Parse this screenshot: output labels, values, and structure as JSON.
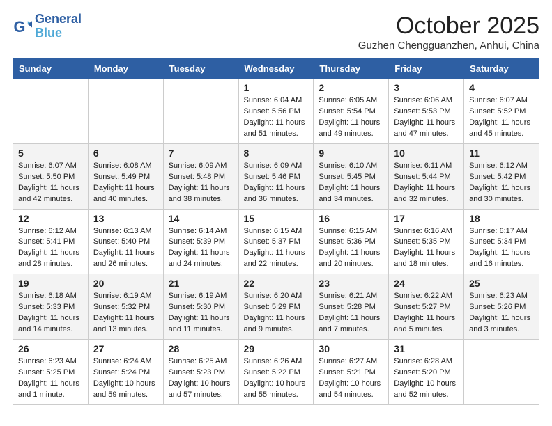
{
  "header": {
    "logo_line1": "General",
    "logo_line2": "Blue",
    "month": "October 2025",
    "location": "Guzhen Chengguanzhen, Anhui, China"
  },
  "weekdays": [
    "Sunday",
    "Monday",
    "Tuesday",
    "Wednesday",
    "Thursday",
    "Friday",
    "Saturday"
  ],
  "weeks": [
    [
      {
        "day": "",
        "info": ""
      },
      {
        "day": "",
        "info": ""
      },
      {
        "day": "",
        "info": ""
      },
      {
        "day": "1",
        "info": "Sunrise: 6:04 AM\nSunset: 5:56 PM\nDaylight: 11 hours\nand 51 minutes."
      },
      {
        "day": "2",
        "info": "Sunrise: 6:05 AM\nSunset: 5:54 PM\nDaylight: 11 hours\nand 49 minutes."
      },
      {
        "day": "3",
        "info": "Sunrise: 6:06 AM\nSunset: 5:53 PM\nDaylight: 11 hours\nand 47 minutes."
      },
      {
        "day": "4",
        "info": "Sunrise: 6:07 AM\nSunset: 5:52 PM\nDaylight: 11 hours\nand 45 minutes."
      }
    ],
    [
      {
        "day": "5",
        "info": "Sunrise: 6:07 AM\nSunset: 5:50 PM\nDaylight: 11 hours\nand 42 minutes."
      },
      {
        "day": "6",
        "info": "Sunrise: 6:08 AM\nSunset: 5:49 PM\nDaylight: 11 hours\nand 40 minutes."
      },
      {
        "day": "7",
        "info": "Sunrise: 6:09 AM\nSunset: 5:48 PM\nDaylight: 11 hours\nand 38 minutes."
      },
      {
        "day": "8",
        "info": "Sunrise: 6:09 AM\nSunset: 5:46 PM\nDaylight: 11 hours\nand 36 minutes."
      },
      {
        "day": "9",
        "info": "Sunrise: 6:10 AM\nSunset: 5:45 PM\nDaylight: 11 hours\nand 34 minutes."
      },
      {
        "day": "10",
        "info": "Sunrise: 6:11 AM\nSunset: 5:44 PM\nDaylight: 11 hours\nand 32 minutes."
      },
      {
        "day": "11",
        "info": "Sunrise: 6:12 AM\nSunset: 5:42 PM\nDaylight: 11 hours\nand 30 minutes."
      }
    ],
    [
      {
        "day": "12",
        "info": "Sunrise: 6:12 AM\nSunset: 5:41 PM\nDaylight: 11 hours\nand 28 minutes."
      },
      {
        "day": "13",
        "info": "Sunrise: 6:13 AM\nSunset: 5:40 PM\nDaylight: 11 hours\nand 26 minutes."
      },
      {
        "day": "14",
        "info": "Sunrise: 6:14 AM\nSunset: 5:39 PM\nDaylight: 11 hours\nand 24 minutes."
      },
      {
        "day": "15",
        "info": "Sunrise: 6:15 AM\nSunset: 5:37 PM\nDaylight: 11 hours\nand 22 minutes."
      },
      {
        "day": "16",
        "info": "Sunrise: 6:15 AM\nSunset: 5:36 PM\nDaylight: 11 hours\nand 20 minutes."
      },
      {
        "day": "17",
        "info": "Sunrise: 6:16 AM\nSunset: 5:35 PM\nDaylight: 11 hours\nand 18 minutes."
      },
      {
        "day": "18",
        "info": "Sunrise: 6:17 AM\nSunset: 5:34 PM\nDaylight: 11 hours\nand 16 minutes."
      }
    ],
    [
      {
        "day": "19",
        "info": "Sunrise: 6:18 AM\nSunset: 5:33 PM\nDaylight: 11 hours\nand 14 minutes."
      },
      {
        "day": "20",
        "info": "Sunrise: 6:19 AM\nSunset: 5:32 PM\nDaylight: 11 hours\nand 13 minutes."
      },
      {
        "day": "21",
        "info": "Sunrise: 6:19 AM\nSunset: 5:30 PM\nDaylight: 11 hours\nand 11 minutes."
      },
      {
        "day": "22",
        "info": "Sunrise: 6:20 AM\nSunset: 5:29 PM\nDaylight: 11 hours\nand 9 minutes."
      },
      {
        "day": "23",
        "info": "Sunrise: 6:21 AM\nSunset: 5:28 PM\nDaylight: 11 hours\nand 7 minutes."
      },
      {
        "day": "24",
        "info": "Sunrise: 6:22 AM\nSunset: 5:27 PM\nDaylight: 11 hours\nand 5 minutes."
      },
      {
        "day": "25",
        "info": "Sunrise: 6:23 AM\nSunset: 5:26 PM\nDaylight: 11 hours\nand 3 minutes."
      }
    ],
    [
      {
        "day": "26",
        "info": "Sunrise: 6:23 AM\nSunset: 5:25 PM\nDaylight: 11 hours\nand 1 minute."
      },
      {
        "day": "27",
        "info": "Sunrise: 6:24 AM\nSunset: 5:24 PM\nDaylight: 10 hours\nand 59 minutes."
      },
      {
        "day": "28",
        "info": "Sunrise: 6:25 AM\nSunset: 5:23 PM\nDaylight: 10 hours\nand 57 minutes."
      },
      {
        "day": "29",
        "info": "Sunrise: 6:26 AM\nSunset: 5:22 PM\nDaylight: 10 hours\nand 55 minutes."
      },
      {
        "day": "30",
        "info": "Sunrise: 6:27 AM\nSunset: 5:21 PM\nDaylight: 10 hours\nand 54 minutes."
      },
      {
        "day": "31",
        "info": "Sunrise: 6:28 AM\nSunset: 5:20 PM\nDaylight: 10 hours\nand 52 minutes."
      },
      {
        "day": "",
        "info": ""
      }
    ]
  ]
}
